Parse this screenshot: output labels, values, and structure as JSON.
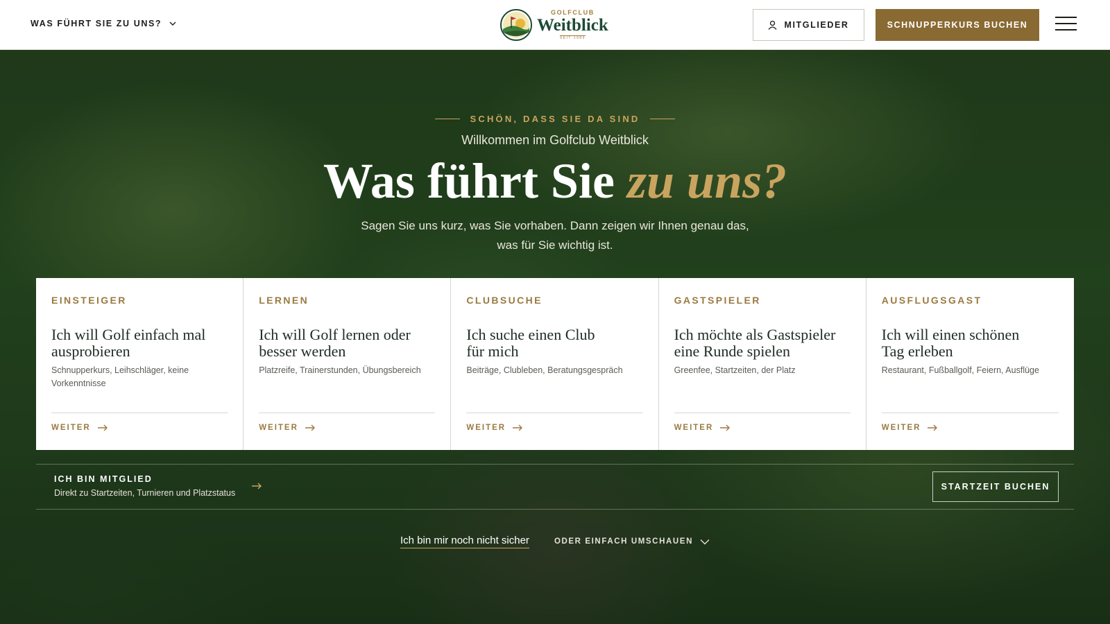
{
  "header": {
    "nav_label": "WAS FÜHRT SIE ZU UNS?",
    "logo_small": "GOLFCLUB",
    "logo_name": "Weitblick",
    "logo_since": "SEIT 1989",
    "members_label": "MITGLIEDER",
    "book_label": "SCHNUPPERKURS BUCHEN"
  },
  "hero": {
    "eyebrow": "SCHÖN, DASS SIE DA SIND",
    "welcome": "Willkommen im Golfclub Weitblick",
    "headline_main": "Was führt Sie ",
    "headline_accent": "zu uns?",
    "lead_line1": "Sagen Sie uns kurz, was Sie vorhaben. Dann zeigen wir Ihnen genau das,",
    "lead_line2": "was für Sie wichtig ist."
  },
  "cards": [
    {
      "category": "EINSTEIGER",
      "title_l1": "Ich will Golf einfach mal",
      "title_l2": "ausprobieren",
      "desc": "Schnupperkurs, Leihschläger, keine Vorkenntnisse",
      "more": "WEITER"
    },
    {
      "category": "LERNEN",
      "title_l1": "Ich will Golf lernen oder",
      "title_l2": "besser werden",
      "desc": "Platzreife, Trainerstunden, Übungsbereich",
      "more": "WEITER"
    },
    {
      "category": "CLUBSUCHE",
      "title_l1": "Ich suche einen Club",
      "title_l2": "für mich",
      "desc": "Beiträge, Clubleben, Beratungsgespräch",
      "more": "WEITER"
    },
    {
      "category": "GASTSPIELER",
      "title_l1": "Ich möchte als Gastspieler",
      "title_l2": "eine Runde spielen",
      "desc": "Greenfee, Startzeiten, der Platz",
      "more": "WEITER"
    },
    {
      "category": "AUSFLUGSGAST",
      "title_l1": "Ich will einen schönen",
      "title_l2": "Tag erleben",
      "desc": "Restaurant, Fußballgolf, Feiern, Ausflüge",
      "more": "WEITER"
    }
  ],
  "member_bar": {
    "title": "ICH BIN MITGLIED",
    "subtitle": "Direkt zu Startzeiten, Turnieren und Platzstatus",
    "tee_label": "STARTZEIT BUCHEN"
  },
  "bottom": {
    "unsure": "Ich bin mir noch nicht sicher",
    "browse": "ODER EINFACH UMSCHAUEN"
  },
  "colors": {
    "gold": "#c9a45f",
    "brand_brown": "#8a6a33",
    "brand_green": "#1e4a35"
  }
}
